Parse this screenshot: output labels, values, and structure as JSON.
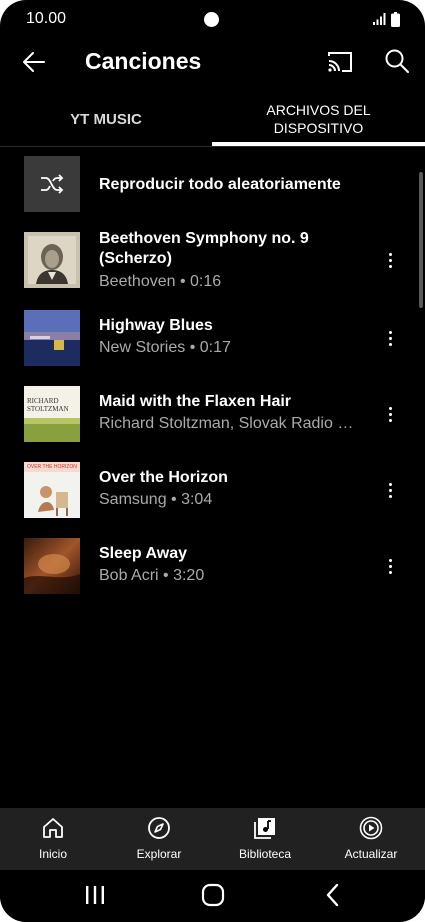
{
  "status_bar": {
    "time": "10.00"
  },
  "app_bar": {
    "title": "Canciones"
  },
  "tabs": [
    {
      "label": "YT MUSIC",
      "selected": false
    },
    {
      "label_line1": "ARCHIVOS DEL",
      "label_line2": "DISPOSITIVO",
      "selected": true
    }
  ],
  "shuffle": {
    "label": "Reproducir todo aleatoriamente"
  },
  "songs": [
    {
      "title_line1": "Beethoven Symphony no. 9",
      "title_line2": "(Scherzo)",
      "subtitle": "Beethoven • 0:16"
    },
    {
      "title_line1": "Highway Blues",
      "subtitle": "New Stories • 0:17"
    },
    {
      "title_line1": "Maid with the Flaxen Hair",
      "subtitle": "Richard Stoltzman, Slovak Radio Symphony Orchestra"
    },
    {
      "title_line1": "Over the Horizon",
      "subtitle": "Samsung • 3:04"
    },
    {
      "title_line1": "Sleep Away",
      "subtitle": "Bob Acri • 3:20"
    }
  ],
  "album_art_text": {
    "maid_line1": "RICHARD",
    "maid_line2": "STOLTZMAN",
    "horizon": "OVER THE HORIZON"
  },
  "bottom_nav": [
    {
      "label": "Inicio"
    },
    {
      "label": "Explorar"
    },
    {
      "label": "Biblioteca"
    },
    {
      "label": "Actualizar"
    }
  ],
  "colors": {
    "background": "#000000",
    "nav_bar": "#212121",
    "secondary_text": "#aaaaaa"
  }
}
